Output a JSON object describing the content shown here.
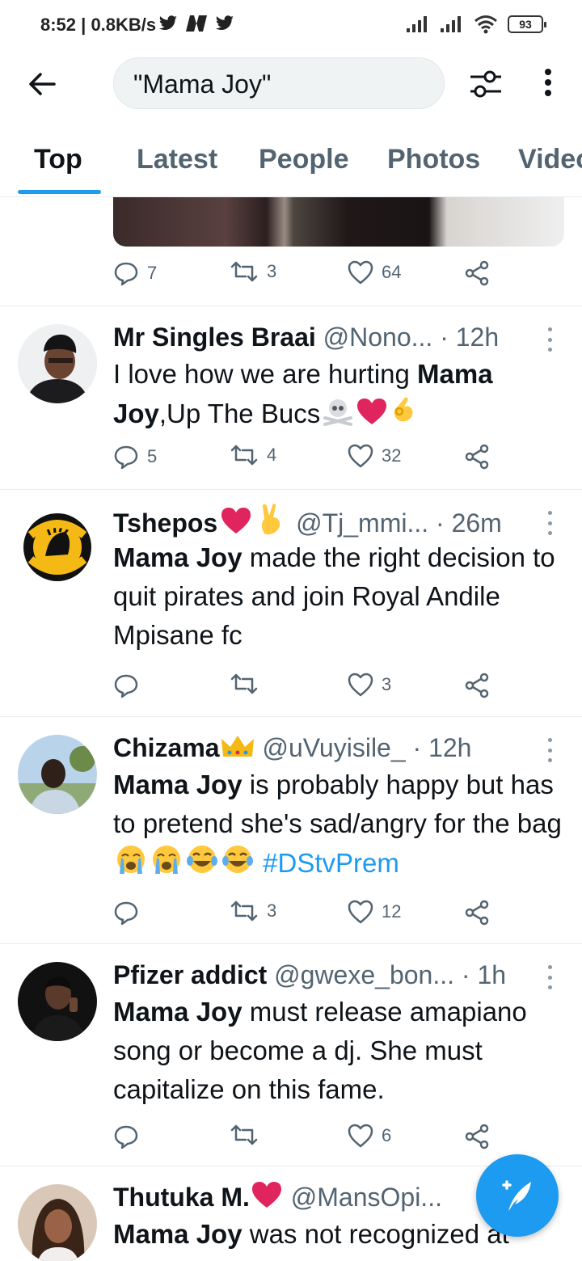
{
  "status_bar": {
    "time": "8:52",
    "speed": "| 0.8KB/s",
    "battery": "93"
  },
  "header": {
    "search_query": "\"Mama Joy\""
  },
  "tabs": [
    {
      "label": "Top",
      "active": true
    },
    {
      "label": "Latest",
      "active": false
    },
    {
      "label": "People",
      "active": false
    },
    {
      "label": "Photos",
      "active": false
    },
    {
      "label": "Videos",
      "active": false
    }
  ],
  "top_tweet_stats": {
    "replies": "7",
    "retweets": "3",
    "likes": "64"
  },
  "tweets": [
    {
      "name": "Mr Singles Braai",
      "handle": "@Nono...",
      "time": "· 12h",
      "text_bold": "Mama Joy",
      "text_pre": "I love how we are hurting ",
      "text_post": ",Up The Bucs",
      "stats": {
        "replies": "5",
        "retweets": "4",
        "likes": "32"
      }
    },
    {
      "name": "Tshepos",
      "handle": "@Tj_mmi...",
      "time": "· 26m",
      "text_bold": "Mama Joy",
      "text_post": " made the right decision to quit pirates and join Royal Andile Mpisane fc",
      "stats": {
        "replies": "",
        "retweets": "",
        "likes": "3"
      }
    },
    {
      "name": "Chizama",
      "handle": "@uVuyisile_",
      "time": "· 12h",
      "text_bold": "Mama Joy",
      "text_post": " is probably happy but has to pretend she's sad/angry for the bag",
      "hashtag": "#DStvPrem",
      "stats": {
        "replies": "",
        "retweets": "3",
        "likes": "12"
      }
    },
    {
      "name": "Pfizer addict",
      "handle": "@gwexe_bon...",
      "time": "· 1h",
      "text_bold": "Mama Joy",
      "text_post": " must release amapiano song or become a dj. She must capitalize on this fame.",
      "stats": {
        "replies": "",
        "retweets": "",
        "likes": "6"
      }
    },
    {
      "name": "Thutuka M.",
      "handle": "@MansOpi...",
      "text_bold": "Mama Joy",
      "text_post": " was not recognized at"
    }
  ],
  "colors": {
    "accent": "#1d9bf0",
    "text_primary": "#0f1419",
    "text_secondary": "#536471",
    "heart_red": "#e0245e"
  }
}
